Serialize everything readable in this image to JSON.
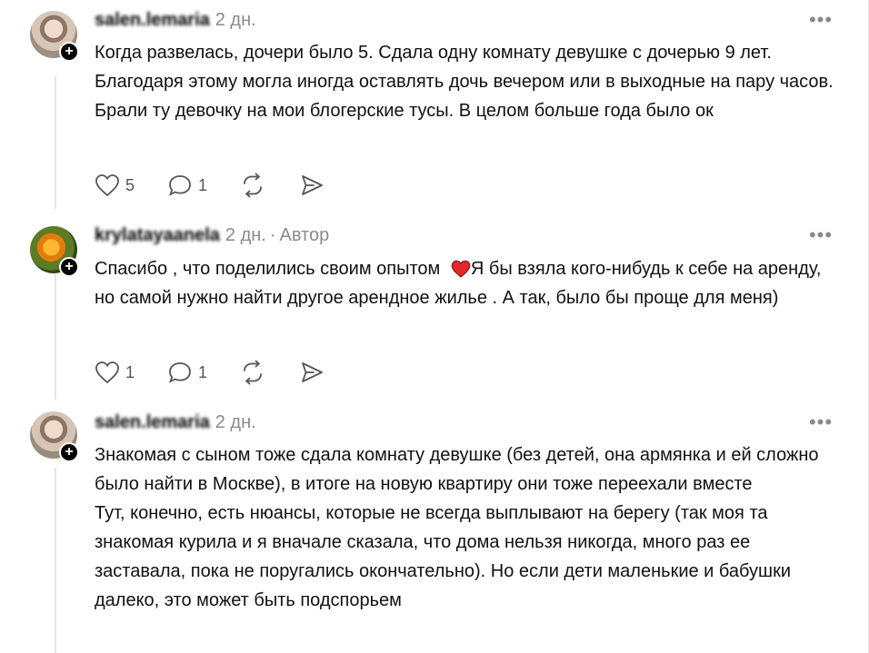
{
  "comments": [
    {
      "author": "salen.lemaria",
      "date": "2 дн.",
      "is_author": false,
      "text": "Когда развелась, дочери было 5. Сдала одну комнату девушке с дочерью 9 лет. Благодаря этому могла иногда оставлять дочь вечером или в выходные на пару часов. Брали ту девочку на мои блогерские тусы. В целом больше года было ок",
      "likes": "5",
      "replies": "1"
    },
    {
      "author": "krylatayaanela",
      "date": "2 дн.",
      "is_author": true,
      "author_badge": "Автор",
      "text_before_emoji": "Спасибо , что поделились своим опытом",
      "text_after_emoji": "Я бы взяла кого-нибудь к себе на аренду, но самой нужно найти другое арендное жилье . А так, было бы проще для меня)",
      "likes": "1",
      "replies": "1"
    },
    {
      "author": "salen.lemaria",
      "date": "2 дн.",
      "is_author": false,
      "paragraph1": "Знакомая с сыном тоже сдала комнату девушке (без детей, она армянка и ей сложно было найти в Москве), в итоге на новую квартиру они тоже переехали вместе",
      "paragraph2": "Тут, конечно, есть нюансы, которые не всегда выплывают на берегу (так моя та знакомая курила и я вначале сказала, что дома нельзя никогда, много раз ее заставала, пока не поругались окончательно). Но если дети маленькие и бабушки далеко, это может быть подспорьем"
    }
  ],
  "ui": {
    "more_glyph": "•••",
    "plus_glyph": "+",
    "dot_separator": "·",
    "icons": [
      "heart-icon",
      "comment-icon",
      "repost-icon",
      "send-icon"
    ],
    "accent_heart_color": "#e0282e"
  }
}
